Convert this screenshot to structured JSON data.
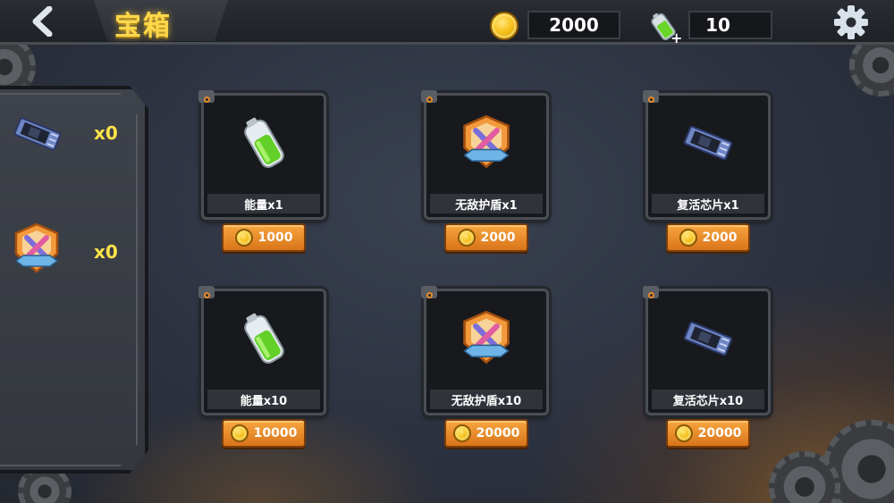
{
  "header": {
    "title": "宝箱",
    "coins": "2000",
    "energy": "10"
  },
  "inventory": [
    {
      "name": "revive-chip",
      "count": "x0"
    },
    {
      "name": "invincible-shield",
      "count": "x0"
    }
  ],
  "shop": {
    "items": [
      {
        "label": "能量x1",
        "price": "1000",
        "icon": "battery-icon"
      },
      {
        "label": "无敌护盾x1",
        "price": "2000",
        "icon": "shield-icon"
      },
      {
        "label": "复活芯片x1",
        "price": "2000",
        "icon": "chip-icon"
      },
      {
        "label": "能量x10",
        "price": "10000",
        "icon": "battery-icon"
      },
      {
        "label": "无敌护盾x10",
        "price": "20000",
        "icon": "shield-icon"
      },
      {
        "label": "复活芯片x10",
        "price": "20000",
        "icon": "chip-icon"
      }
    ]
  },
  "colors": {
    "accent": "#ffd84a",
    "button": "#e88a2a",
    "count": "#ffe34a"
  }
}
